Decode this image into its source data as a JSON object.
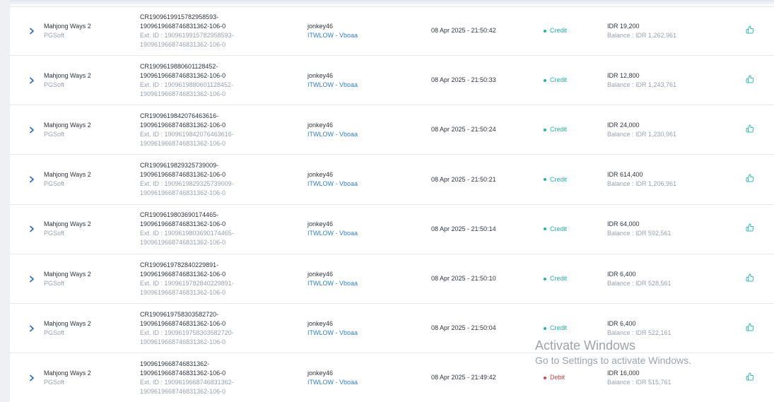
{
  "colors": {
    "credit": "#1fb8a6",
    "debit": "#e0404a",
    "link": "#2d7fd4",
    "like_icon": "#2bbfb0",
    "chevron": "#2d6fc8"
  },
  "icons": {
    "expand": "chevron-right-icon",
    "action": "thumbs-up-icon"
  },
  "rows": [
    {
      "game": "Mahjong Ways 2",
      "provider": "PGSoft",
      "txn_line1": "CR1909619915782958593-",
      "txn_line2": "1909619668746831362-106-0",
      "ext_line1": "Ext. ID : 1909619915782958593-",
      "ext_line2": "1909619668746831362-106-0",
      "user": "jonkey46",
      "agent": "ITWLOW - Vboaa",
      "datetime": "08 Apr 2025 - 21:50:42",
      "type": "Credit",
      "amount": "IDR 19,200",
      "balance": "Balance : IDR 1,262,961"
    },
    {
      "game": "Mahjong Ways 2",
      "provider": "PGSoft",
      "txn_line1": "CR1909619880601128452-",
      "txn_line2": "1909619668746831362-106-0",
      "ext_line1": "Ext. ID : 1909619880601128452-",
      "ext_line2": "1909619668746831362-106-0",
      "user": "jonkey46",
      "agent": "ITWLOW - Vboaa",
      "datetime": "08 Apr 2025 - 21:50:33",
      "type": "Credit",
      "amount": "IDR 12,800",
      "balance": "Balance : IDR 1,243,761"
    },
    {
      "game": "Mahjong Ways 2",
      "provider": "PGSoft",
      "txn_line1": "CR1909619842076463616-",
      "txn_line2": "1909619668746831362-106-0",
      "ext_line1": "Ext. ID : 1909619842076463616-",
      "ext_line2": "1909619668746831362-106-0",
      "user": "jonkey46",
      "agent": "ITWLOW - Vboaa",
      "datetime": "08 Apr 2025 - 21:50:24",
      "type": "Credit",
      "amount": "IDR 24,000",
      "balance": "Balance : IDR 1,230,961"
    },
    {
      "game": "Mahjong Ways 2",
      "provider": "PGSoft",
      "txn_line1": "CR1909619829325739009-",
      "txn_line2": "1909619668746831362-106-0",
      "ext_line1": "Ext. ID : 1909619829325739009-",
      "ext_line2": "1909619668746831362-106-0",
      "user": "jonkey46",
      "agent": "ITWLOW - Vboaa",
      "datetime": "08 Apr 2025 - 21:50:21",
      "type": "Credit",
      "amount": "IDR 614,400",
      "balance": "Balance : IDR 1,206,961"
    },
    {
      "game": "Mahjong Ways 2",
      "provider": "PGSoft",
      "txn_line1": "CR1909619803690174465-",
      "txn_line2": "1909619668746831362-106-0",
      "ext_line1": "Ext. ID : 1909619803690174465-",
      "ext_line2": "1909619668746831362-106-0",
      "user": "jonkey46",
      "agent": "ITWLOW - Vboaa",
      "datetime": "08 Apr 2025 - 21:50:14",
      "type": "Credit",
      "amount": "IDR 64,000",
      "balance": "Balance : IDR 592,561"
    },
    {
      "game": "Mahjong Ways 2",
      "provider": "PGSoft",
      "txn_line1": "CR1909619782840229891-",
      "txn_line2": "1909619668746831362-106-0",
      "ext_line1": "Ext. ID : 1909619782840229891-",
      "ext_line2": "1909619668746831362-106-0",
      "user": "jonkey46",
      "agent": "ITWLOW - Vboaa",
      "datetime": "08 Apr 2025 - 21:50:10",
      "type": "Credit",
      "amount": "IDR 6,400",
      "balance": "Balance : IDR 528,561"
    },
    {
      "game": "Mahjong Ways 2",
      "provider": "PGSoft",
      "txn_line1": "CR1909619758303582720-",
      "txn_line2": "1909619668746831362-106-0",
      "ext_line1": "Ext. ID : 1909619758303582720-",
      "ext_line2": "1909619668746831362-106-0",
      "user": "jonkey46",
      "agent": "ITWLOW - Vboaa",
      "datetime": "08 Apr 2025 - 21:50:04",
      "type": "Credit",
      "amount": "IDR 6,400",
      "balance": "Balance : IDR 522,161"
    },
    {
      "game": "Mahjong Ways 2",
      "provider": "PGSoft",
      "txn_line1": "1909619668746831362-",
      "txn_line2": "1909619668746831362-106-0",
      "ext_line1": "Ext. ID : 1909619668746831362-",
      "ext_line2": "1909619668746831362-106-0",
      "user": "jonkey46",
      "agent": "ITWLOW - Vboaa",
      "datetime": "08 Apr 2025 - 21:49:42",
      "type": "Debit",
      "amount": "IDR 16,000",
      "balance": "Balance : IDR 515,761"
    }
  ],
  "watermark": {
    "title": "Activate Windows",
    "subtitle": "Go to Settings to activate Windows."
  }
}
